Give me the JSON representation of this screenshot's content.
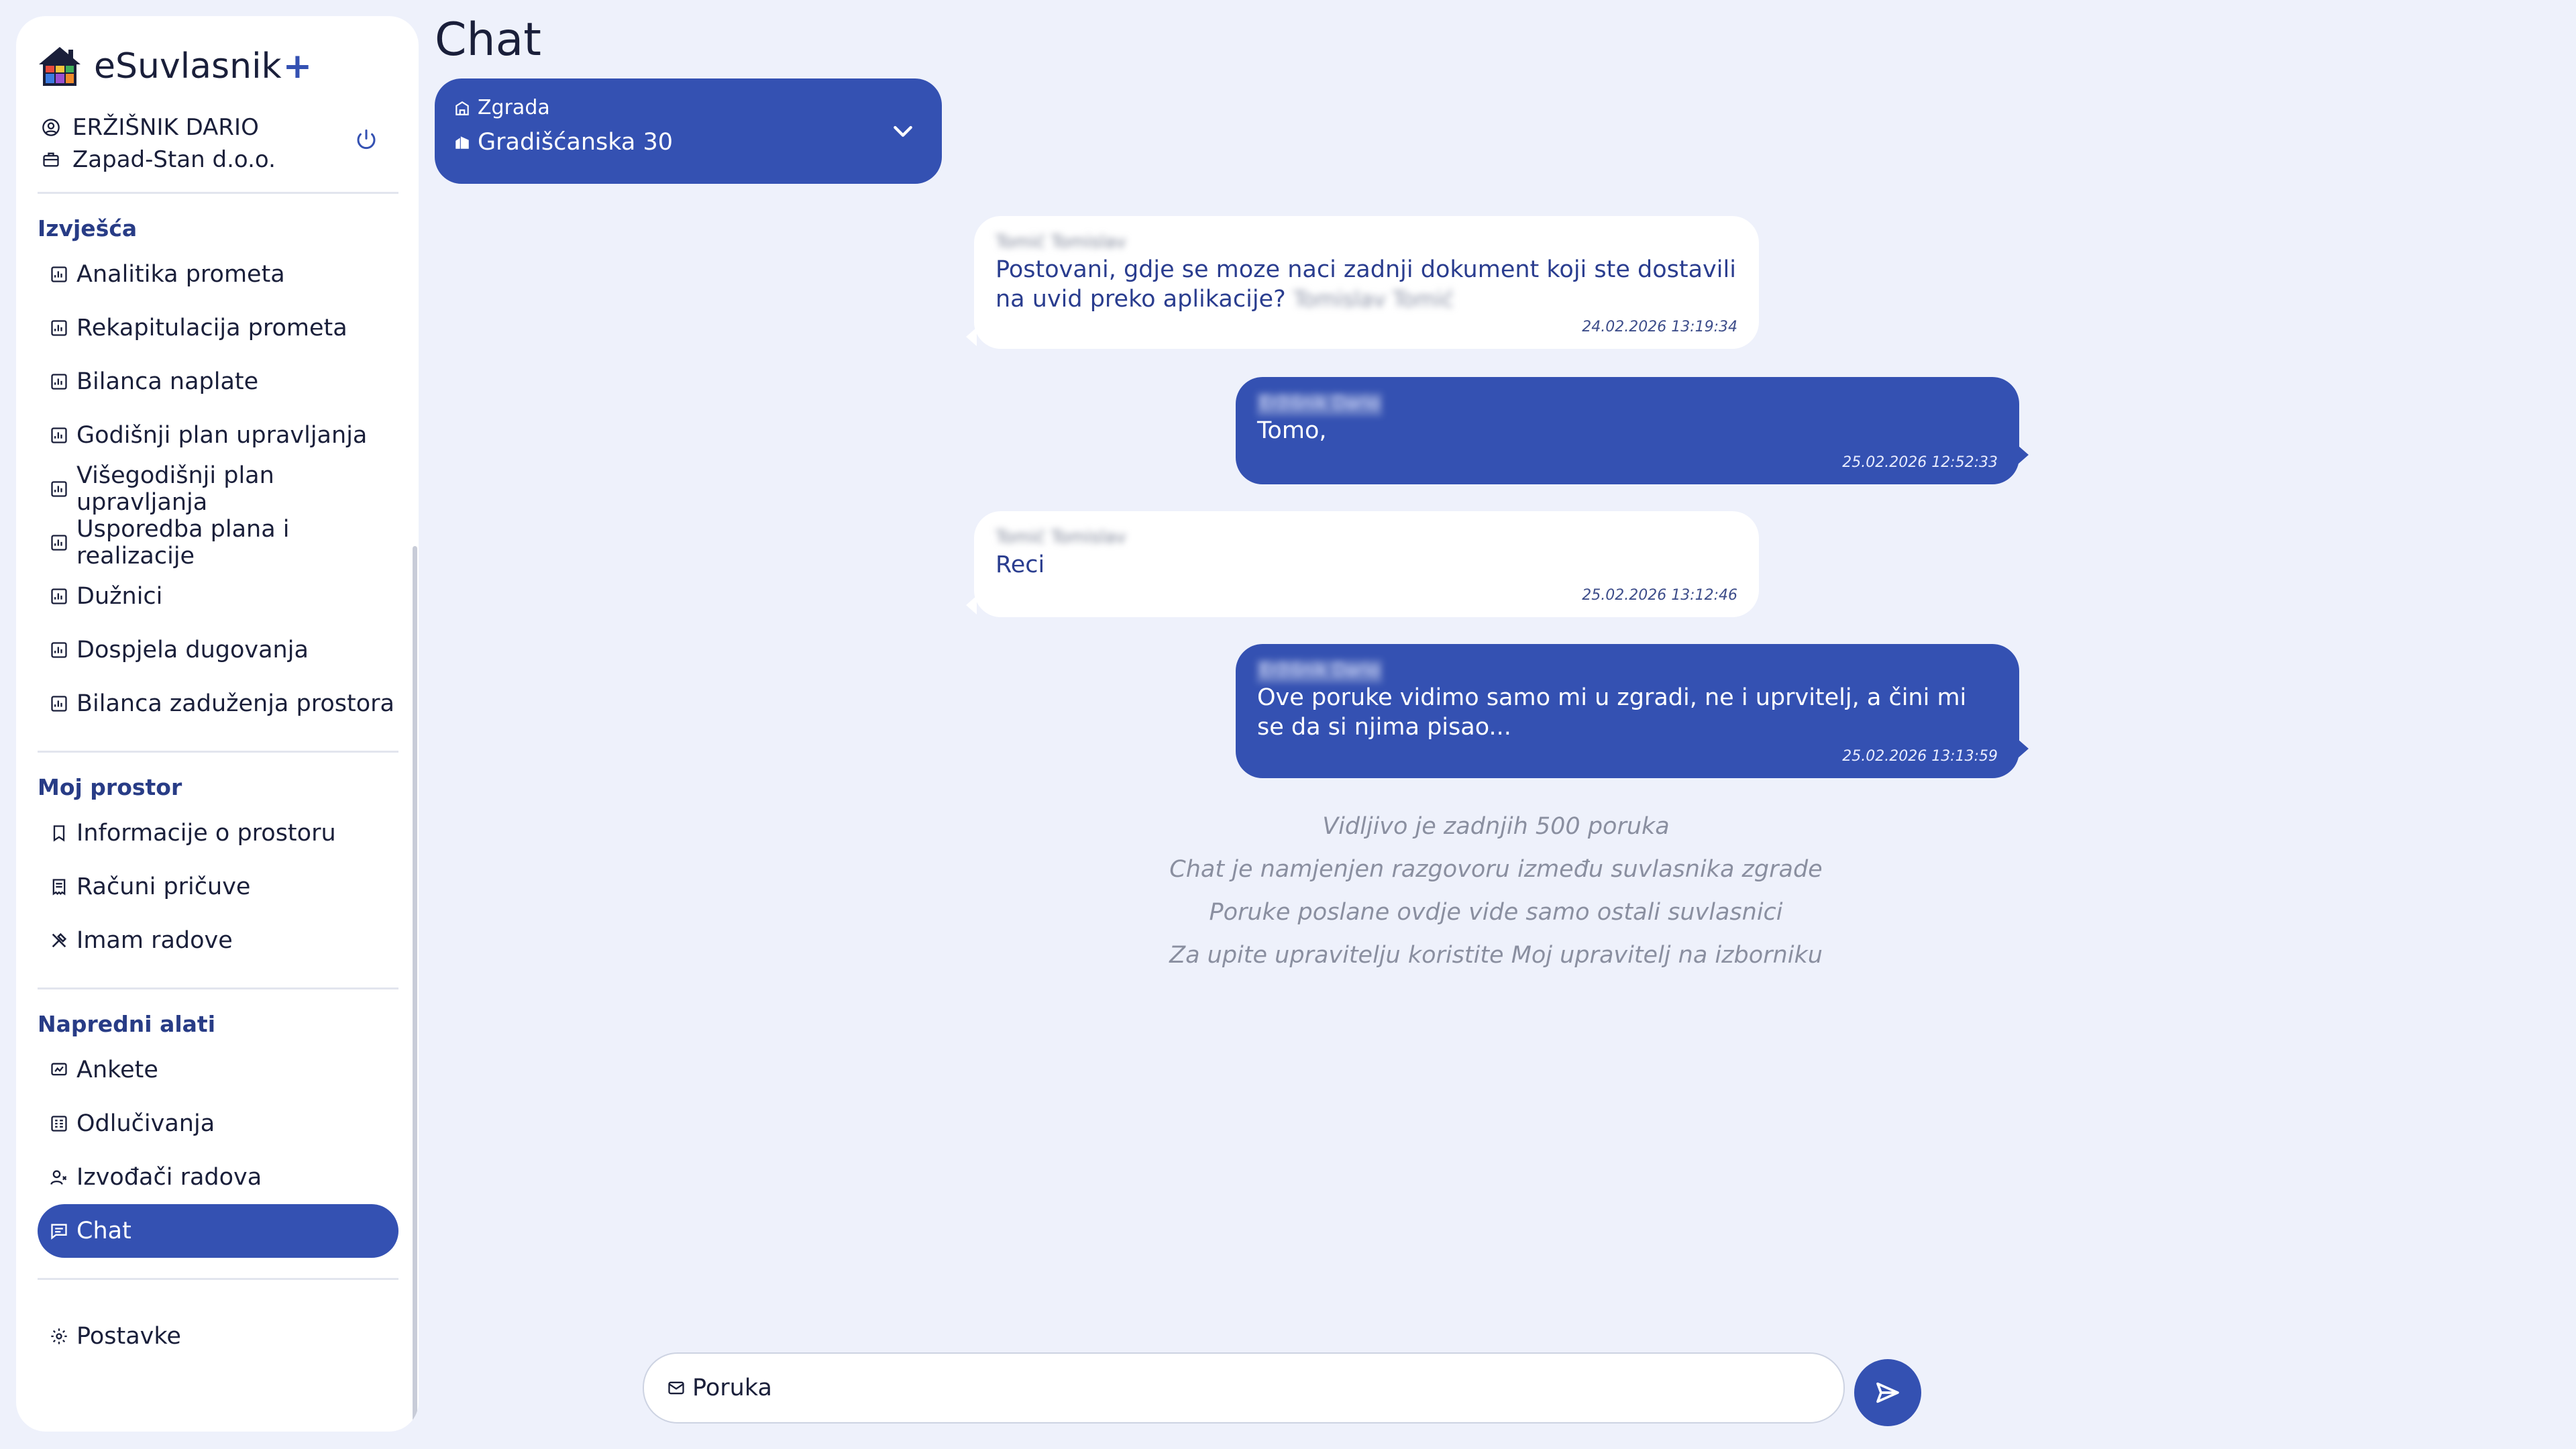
{
  "app": {
    "name": "eSuvlasnik",
    "plus": "+"
  },
  "user": {
    "name": "ERŽIŠNIK DARIO",
    "company": "Zapad-Stan d.o.o."
  },
  "sidebar": {
    "sections": [
      {
        "title": "Izvješća",
        "items": [
          {
            "label": "Analitika prometa",
            "icon": "chart-icon"
          },
          {
            "label": "Rekapitulacija prometa",
            "icon": "chart-icon"
          },
          {
            "label": "Bilanca naplate",
            "icon": "chart-icon"
          },
          {
            "label": "Godišnji plan upravljanja",
            "icon": "chart-icon"
          },
          {
            "label": "Višegodišnji plan upravljanja",
            "icon": "chart-icon"
          },
          {
            "label": "Usporedba plana i realizacije",
            "icon": "chart-icon"
          },
          {
            "label": "Dužnici",
            "icon": "chart-icon"
          },
          {
            "label": "Dospjela dugovanja",
            "icon": "chart-icon"
          },
          {
            "label": "Bilanca zaduženja prostora",
            "icon": "chart-icon"
          }
        ]
      },
      {
        "title": "Moj prostor",
        "items": [
          {
            "label": "Informacije o prostoru",
            "icon": "bookmark-icon"
          },
          {
            "label": "Računi pričuve",
            "icon": "receipt-icon"
          },
          {
            "label": "Imam radove",
            "icon": "tools-icon"
          }
        ]
      },
      {
        "title": "Napredni alati",
        "items": [
          {
            "label": "Ankete",
            "icon": "poll-icon"
          },
          {
            "label": "Odlučivanja",
            "icon": "ballot-icon"
          },
          {
            "label": "Izvođači radova",
            "icon": "contractor-icon"
          },
          {
            "label": "Chat",
            "icon": "chat-icon",
            "active": true
          }
        ]
      }
    ],
    "settings_label": "Postavke"
  },
  "page": {
    "title": "Chat"
  },
  "building": {
    "label": "Zgrada",
    "value": "Gradišćanska 30"
  },
  "messages": [
    {
      "direction": "in",
      "sender": "Tomić Tomislav",
      "text": "Postovani, gdje se moze naci zadnji dokument koji ste dostavili na uvid preko aplikacije?",
      "signature": "Tomislav Tomić",
      "time": "24.02.2026 13:19:34"
    },
    {
      "direction": "out",
      "sender": "Eržišnik Dario",
      "text": "Tomo,",
      "time": "25.02.2026 12:52:33"
    },
    {
      "direction": "in",
      "sender": "Tomić Tomislav",
      "text": "Reci",
      "time": "25.02.2026 13:12:46"
    },
    {
      "direction": "out",
      "sender": "Eržišnik Dario",
      "text": "Ove poruke vidimo samo mi u zgradi, ne i uprvitelj, a čini mi se da si njima pisao...",
      "time": "25.02.2026 13:13:59"
    }
  ],
  "info": [
    "Vidljivo je zadnjih 500 poruka",
    "Chat je namjenjen razgovoru između suvlasnika zgrade",
    "Poruke poslane ovdje vide samo ostali suvlasnici",
    "Za upite upravitelju koristite Moj upravitelj na izborniku"
  ],
  "composer": {
    "placeholder": "Poruka"
  },
  "colors": {
    "accent": "#3451b2",
    "background": "#eef1fb",
    "section_title": "#283c86"
  }
}
